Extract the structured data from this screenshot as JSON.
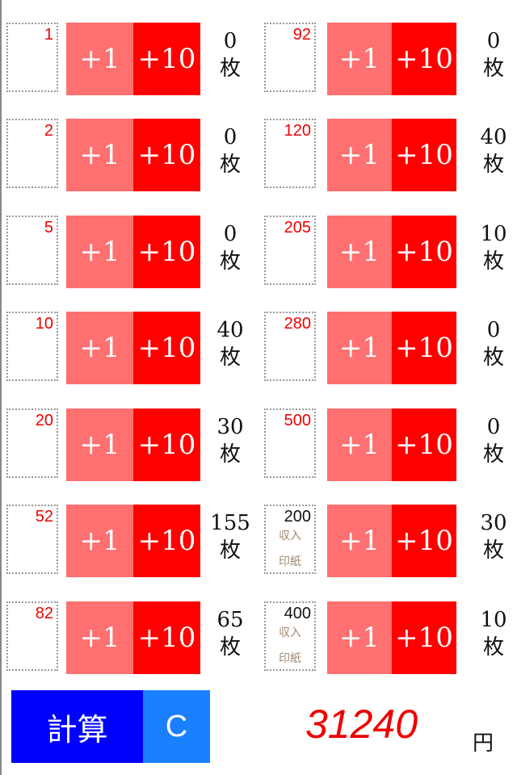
{
  "button_labels": {
    "plus1": "+1",
    "plus10": "+10"
  },
  "unit": "枚",
  "left": [
    {
      "denomination": "1",
      "count": "0"
    },
    {
      "denomination": "2",
      "count": "0"
    },
    {
      "denomination": "5",
      "count": "0"
    },
    {
      "denomination": "10",
      "count": "40"
    },
    {
      "denomination": "20",
      "count": "30"
    },
    {
      "denomination": "52",
      "count": "155"
    },
    {
      "denomination": "82",
      "count": "65"
    }
  ],
  "right": [
    {
      "denomination": "92",
      "count": "0"
    },
    {
      "denomination": "120",
      "count": "40"
    },
    {
      "denomination": "205",
      "count": "10"
    },
    {
      "denomination": "280",
      "count": "0"
    },
    {
      "denomination": "500",
      "count": "0"
    },
    {
      "denomination": "200",
      "count": "30",
      "revenue_line1": "収入",
      "revenue_line2": "印紙"
    },
    {
      "denomination": "400",
      "count": "10",
      "revenue_line1": "収入",
      "revenue_line2": "印紙"
    }
  ],
  "footer": {
    "calculate": "計算",
    "clear": "C",
    "total": "31240",
    "currency": "円"
  },
  "colors": {
    "plus1": "#ff7070",
    "plus10": "#ff0000",
    "calculate": "#0000ff",
    "clear": "#1a80ff",
    "total": "#ee0000"
  }
}
